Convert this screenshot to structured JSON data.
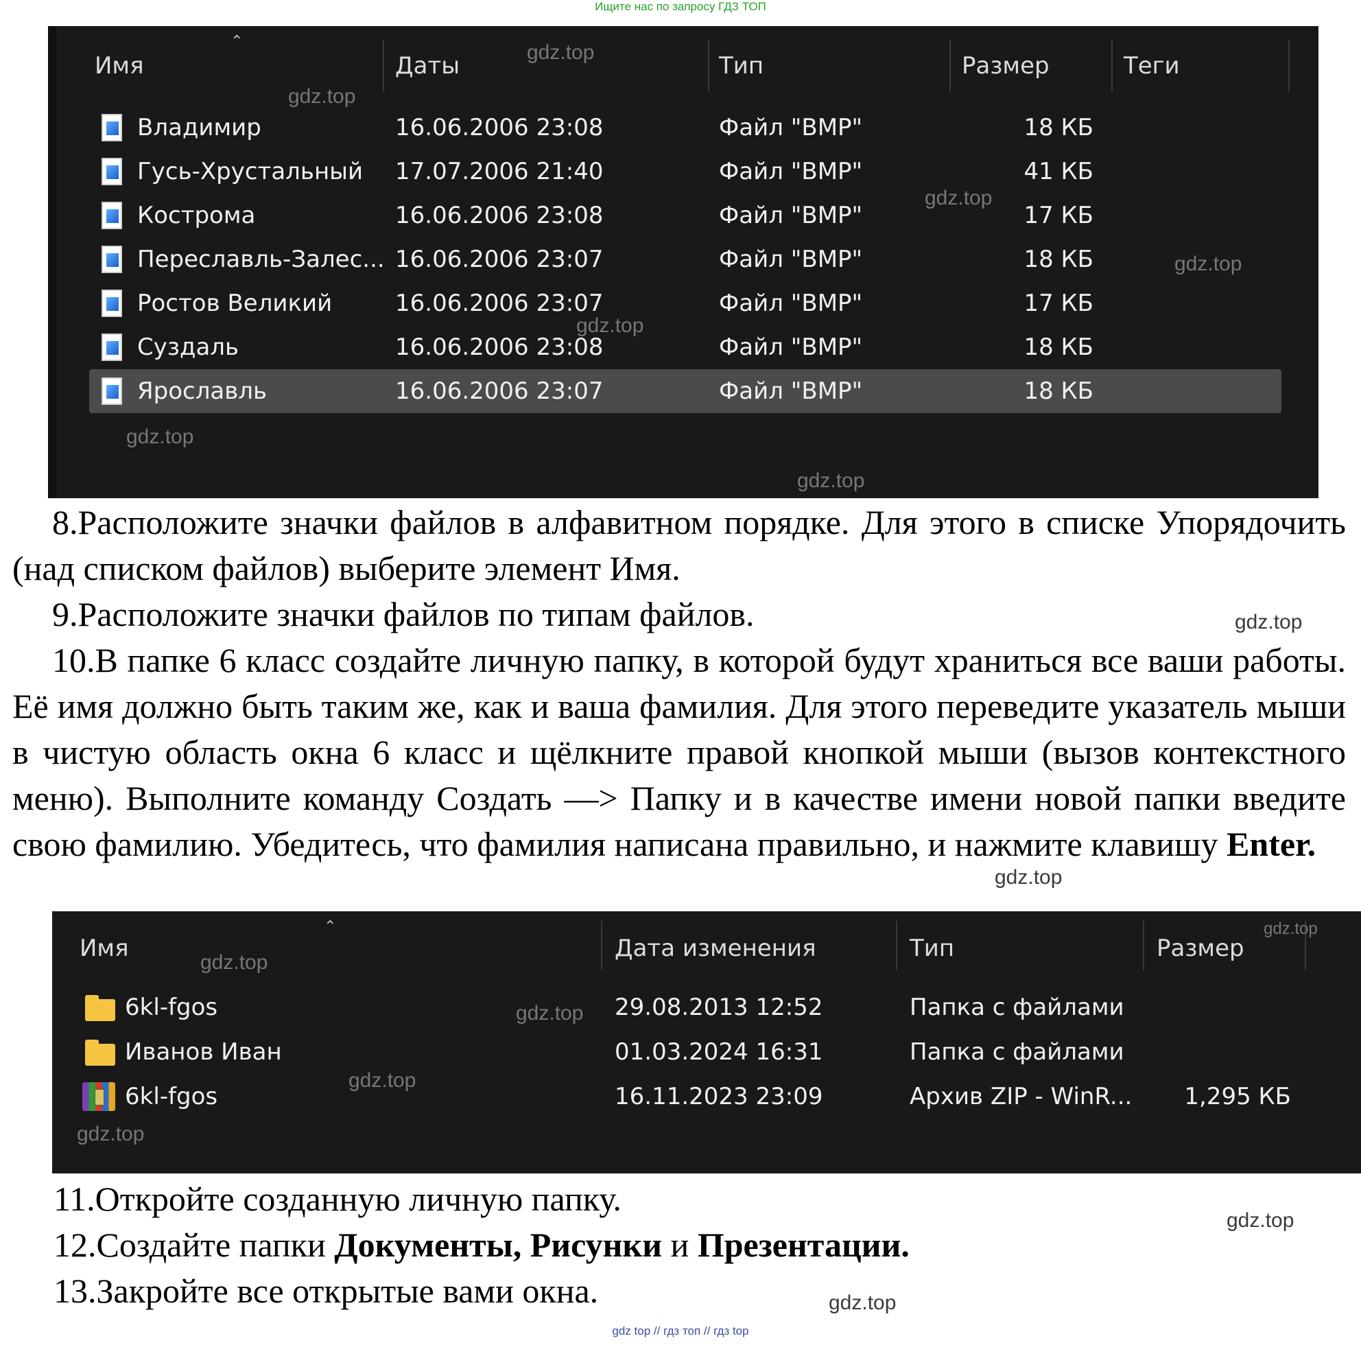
{
  "banner": "Ищите нас по запросу ГДЗ ТОП",
  "window1": {
    "headers": [
      "Имя",
      "Даты",
      "Тип",
      "Размер",
      "Теги"
    ],
    "rows": [
      {
        "name": "Владимир",
        "date": "16.06.2006 23:08",
        "type": "Файл \"BMP\"",
        "size": "18 КБ"
      },
      {
        "name": "Гусь-Хрустальный",
        "date": "17.07.2006 21:40",
        "type": "Файл \"BMP\"",
        "size": "41 КБ"
      },
      {
        "name": "Кострома",
        "date": "16.06.2006 23:08",
        "type": "Файл \"BMP\"",
        "size": "17 КБ"
      },
      {
        "name": "Переславль-Залес...",
        "date": "16.06.2006 23:07",
        "type": "Файл \"BMP\"",
        "size": "18 КБ"
      },
      {
        "name": "Ростов Великий",
        "date": "16.06.2006 23:07",
        "type": "Файл \"BMP\"",
        "size": "17 КБ"
      },
      {
        "name": "Суздаль",
        "date": "16.06.2006 23:08",
        "type": "Файл \"BMP\"",
        "size": "18 КБ"
      },
      {
        "name": "Ярославль",
        "date": "16.06.2006 23:07",
        "type": "Файл \"BMP\"",
        "size": "18 КБ",
        "selected": true
      }
    ]
  },
  "text": {
    "p8": "8.Расположите значки файлов в алфавитном порядке. Для этого в списке Упорядочить (над списком файлов) выберите элемент Имя.",
    "p9": "9.Расположите значки файлов по типам файлов.",
    "p10": "10.В папке 6 класс создайте личную папку, в которой будут храниться все ваши работы. Её имя должно быть таким же, как и ваша фамилия. Для этого переведите указатель мыши в чистую область окна 6 класс и щёлкните правой кнопкой мыши (вызов контекстного меню). Выполните команду Создать —> Папку и в качестве имени новой папки введите свою фамилию. Убедитесь, что фамилия написана правильно, и нажмите клавишу",
    "p10_key": "Enter.",
    "p11": "11.Откройте созданную личную папку.",
    "p12_pre": "12.Создайте папки",
    "p12_b1": "Документы, Рисунки",
    "p12_mid": "и",
    "p12_b2": "Презентации.",
    "p13": "13.Закройте все открытые вами окна."
  },
  "window2": {
    "headers": [
      "Имя",
      "Дата изменения",
      "Тип",
      "Размер"
    ],
    "rows": [
      {
        "icon": "folder-icon",
        "name": "6kl-fgos",
        "date": "29.08.2013 12:52",
        "type": "Папка с файлами",
        "size": ""
      },
      {
        "icon": "folder-icon",
        "name": "Иванов Иван",
        "date": "01.03.2024 16:31",
        "type": "Папка с файлами",
        "size": ""
      },
      {
        "icon": "winrar-archive-icon",
        "name": "6kl-fgos",
        "date": "16.11.2023 23:09",
        "type": "Архив ZIP - WinR...",
        "size": "1,295 КБ"
      }
    ]
  },
  "watermark": "gdz.top",
  "bottom_links": "gdz top  //  гдз топ  //  гдз top"
}
